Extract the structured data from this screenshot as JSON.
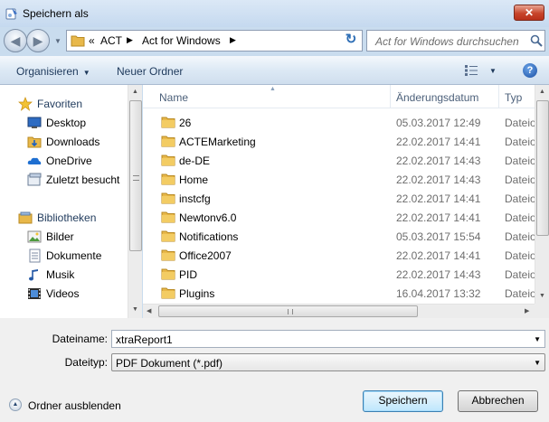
{
  "window": {
    "title": "Speichern als",
    "close_glyph": "✕"
  },
  "nav": {
    "back_glyph": "◀",
    "forward_glyph": "▶",
    "address": {
      "overflow": "«",
      "parts": [
        "ACT",
        "Act for Windows"
      ],
      "sep_glyph": "▶"
    },
    "refresh_glyph": "↻",
    "search_placeholder": "Act for Windows durchsuchen"
  },
  "toolbar": {
    "organize_label": "Organisieren",
    "new_folder_label": "Neuer Ordner",
    "caret": "▼",
    "help_label": "?"
  },
  "sidebar": {
    "favorites": {
      "label": "Favoriten",
      "items": [
        {
          "label": "Desktop",
          "icon": "desktop-icon"
        },
        {
          "label": "Downloads",
          "icon": "downloads-icon"
        },
        {
          "label": "OneDrive",
          "icon": "onedrive-icon"
        },
        {
          "label": "Zuletzt besucht",
          "icon": "recent-places-icon"
        }
      ]
    },
    "libraries": {
      "label": "Bibliotheken",
      "items": [
        {
          "label": "Bilder",
          "icon": "pictures-icon"
        },
        {
          "label": "Dokumente",
          "icon": "documents-icon"
        },
        {
          "label": "Musik",
          "icon": "music-icon"
        },
        {
          "label": "Videos",
          "icon": "videos-icon"
        }
      ]
    }
  },
  "files": {
    "columns": {
      "name": "Name",
      "date": "Änderungsdatum",
      "type": "Typ"
    },
    "sort_glyph": "▲",
    "rows": [
      {
        "name": "26",
        "date": "05.03.2017 12:49",
        "type": "Dateio"
      },
      {
        "name": "ACTEMarketing",
        "date": "22.02.2017 14:41",
        "type": "Dateio"
      },
      {
        "name": "de-DE",
        "date": "22.02.2017 14:43",
        "type": "Dateio"
      },
      {
        "name": "Home",
        "date": "22.02.2017 14:43",
        "type": "Dateio"
      },
      {
        "name": "instcfg",
        "date": "22.02.2017 14:41",
        "type": "Dateio"
      },
      {
        "name": "Newtonv6.0",
        "date": "22.02.2017 14:41",
        "type": "Dateio"
      },
      {
        "name": "Notifications",
        "date": "05.03.2017 15:54",
        "type": "Dateio"
      },
      {
        "name": "Office2007",
        "date": "22.02.2017 14:41",
        "type": "Dateio"
      },
      {
        "name": "PID",
        "date": "22.02.2017 14:43",
        "type": "Dateio"
      },
      {
        "name": "Plugins",
        "date": "16.04.2017 13:32",
        "type": "Dateio"
      }
    ]
  },
  "scroll": {
    "up": "▲",
    "down": "▼",
    "left": "◀",
    "right": "▶"
  },
  "form": {
    "filename_label": "Dateiname:",
    "filename_value": "xtraReport1",
    "filetype_label": "Dateityp:",
    "filetype_value": "PDF Dokument (*.pdf)",
    "dropdown_glyph": "▼"
  },
  "footer": {
    "hide_folders_label": "Ordner ausblenden",
    "hide_glyph": "▲",
    "save_label": "Speichern",
    "cancel_label": "Abbrechen"
  }
}
